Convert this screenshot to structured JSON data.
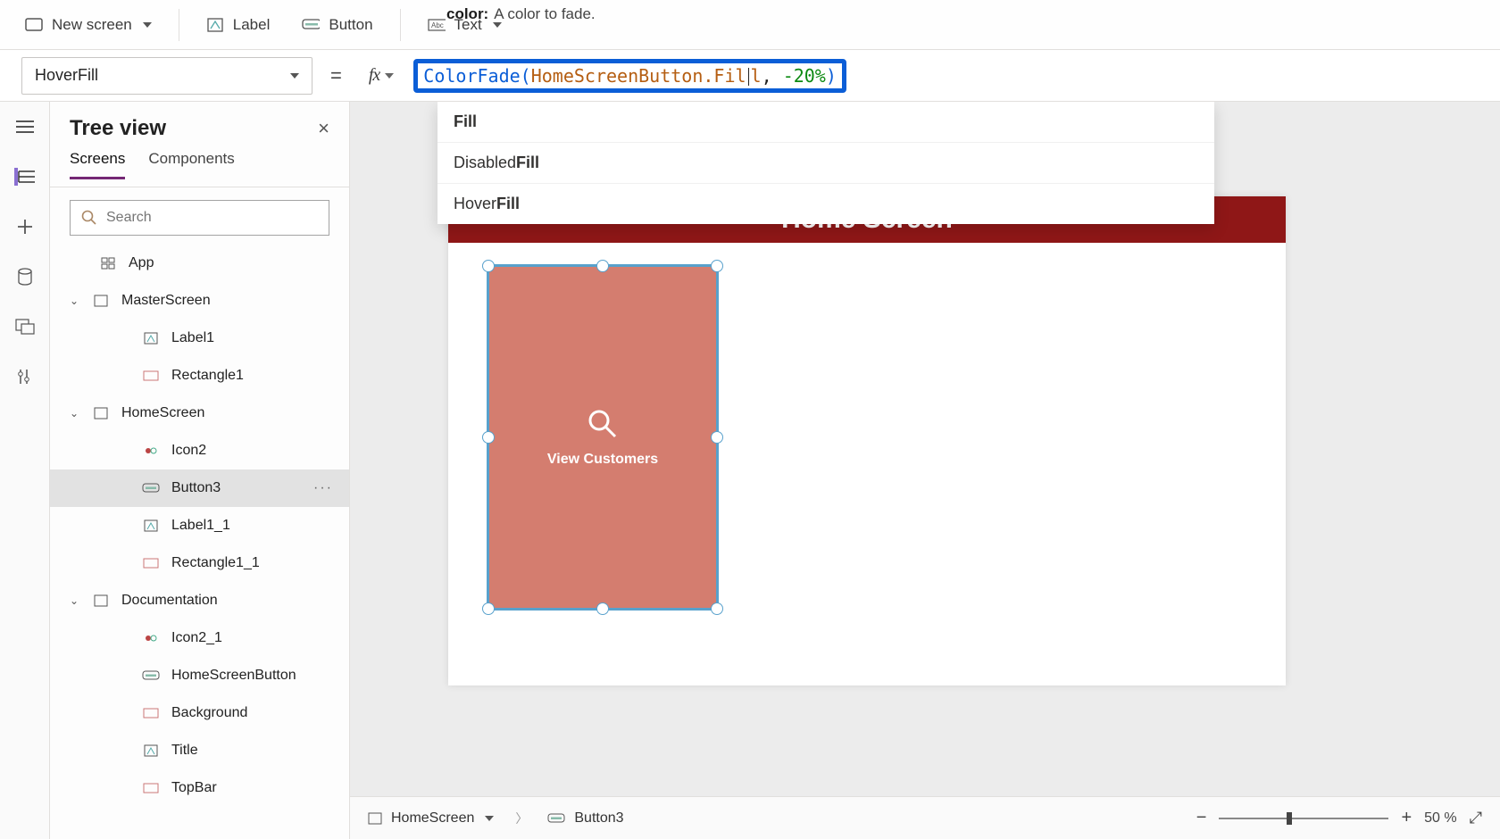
{
  "toolbar": {
    "new_screen": "New screen",
    "label": "Label",
    "button": "Button",
    "text": "Text",
    "tooltip_label": "color:",
    "tooltip_text": "A color to fade."
  },
  "property_selector": "HoverFill",
  "formula": {
    "fn": "ColorFade",
    "arg1": "HomeScreenButton.Fil",
    "arg1_tail": "l",
    "comma": ", ",
    "arg2": "-20%",
    "close": ")"
  },
  "autocomplete": {
    "item1_bold": "Fill",
    "item2_pre": "Disabled",
    "item2_bold": "Fill",
    "item3_pre": "Hover",
    "item3_bold": "Fill"
  },
  "tree": {
    "title": "Tree view",
    "tab_screens": "Screens",
    "tab_components": "Components",
    "search_placeholder": "Search",
    "app": "App",
    "master_screen": "MasterScreen",
    "label1": "Label1",
    "rectangle1": "Rectangle1",
    "home_screen": "HomeScreen",
    "icon2": "Icon2",
    "button3": "Button3",
    "label1_1": "Label1_1",
    "rectangle1_1": "Rectangle1_1",
    "documentation": "Documentation",
    "icon2_1": "Icon2_1",
    "home_screen_button": "HomeScreenButton",
    "background": "Background",
    "title_item": "Title",
    "topbar": "TopBar"
  },
  "canvas": {
    "header_text": "Home Screen",
    "button_text": "View Customers"
  },
  "breadcrumb": {
    "screen": "HomeScreen",
    "control": "Button3"
  },
  "zoom": "50  %"
}
